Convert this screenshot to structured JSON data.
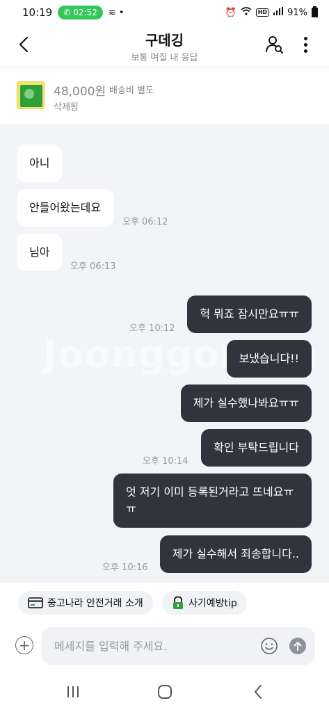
{
  "status_bar": {
    "time": "10:19",
    "call_timer": "02:52",
    "battery_text": "91%",
    "hd_label": "HD"
  },
  "header": {
    "title": "구데깅",
    "subtitle": "보통 며칠 내 응답"
  },
  "product": {
    "price": "48,000원",
    "shipping": "배송비 별도",
    "status": "삭제됨"
  },
  "chat": {
    "watermark": "Joonggonara",
    "messages": [
      {
        "text": "아니",
        "side": "in"
      },
      {
        "text": "안들어왔는데요",
        "side": "in",
        "time": "오후 06:12"
      },
      {
        "text": "님아",
        "side": "in",
        "time": "오후 06:13"
      },
      {
        "text": "헉 뭐죠 잠시만요ㅠㅠ",
        "side": "out",
        "time": "오후 10:12"
      },
      {
        "text": "보냈습니다!!",
        "side": "out"
      },
      {
        "text": "제가 실수했나봐요ㅠㅠ",
        "side": "out"
      },
      {
        "text": "확인 부탁드립니다",
        "side": "out",
        "time": "오후 10:14"
      },
      {
        "text_line1": "엇 저기 이미 등록된거라고 뜨네요ㅠ",
        "text_line2": "ㅠ",
        "side": "out"
      },
      {
        "text": "제가 실수해서 죄송합니다..",
        "side": "out",
        "time": "오후 10:16"
      }
    ]
  },
  "quick_actions": {
    "safe_trade": "중고나라 안전거래 소개",
    "fraud_tip": "사기예방tip"
  },
  "input": {
    "placeholder": "메세지를 입력해 주세요."
  },
  "colors": {
    "outgoing_bubble": "#30353d",
    "incoming_bubble": "#ffffff",
    "chat_background": "#f2f4f7",
    "call_pill": "#34c759"
  }
}
